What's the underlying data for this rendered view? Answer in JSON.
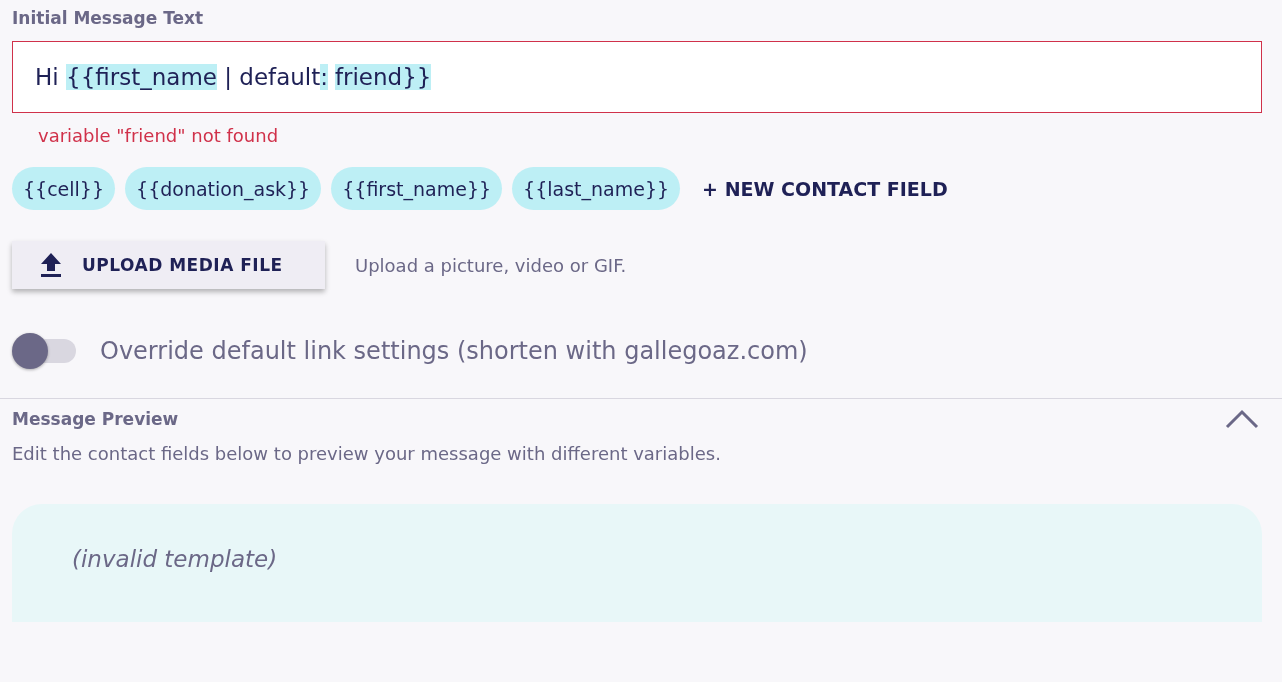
{
  "message_field": {
    "label": "Initial Message Text",
    "segments": [
      {
        "text": "Hi ",
        "highlighted": false
      },
      {
        "text": "{{first_name",
        "highlighted": true
      },
      {
        "text": " | default",
        "highlighted": false
      },
      {
        "text": ":",
        "highlighted": true
      },
      {
        "text": "friend}}",
        "highlighted": true,
        "space_before": true
      }
    ],
    "error": "variable \"friend\" not found"
  },
  "variable_chips": [
    "{{cell}}",
    "{{donation_ask}}",
    "{{first_name}}",
    "{{last_name}}"
  ],
  "new_field_link": "+ NEW CONTACT FIELD",
  "upload": {
    "button": "UPLOAD MEDIA FILE",
    "hint": "Upload a picture, video or GIF."
  },
  "link_override": {
    "label": "Override default link settings (shorten with gallegoaz.com)",
    "on": false
  },
  "preview": {
    "title": "Message Preview",
    "expanded": true,
    "description": "Edit the contact fields below to preview your message with different variables.",
    "message": "(invalid template)"
  }
}
